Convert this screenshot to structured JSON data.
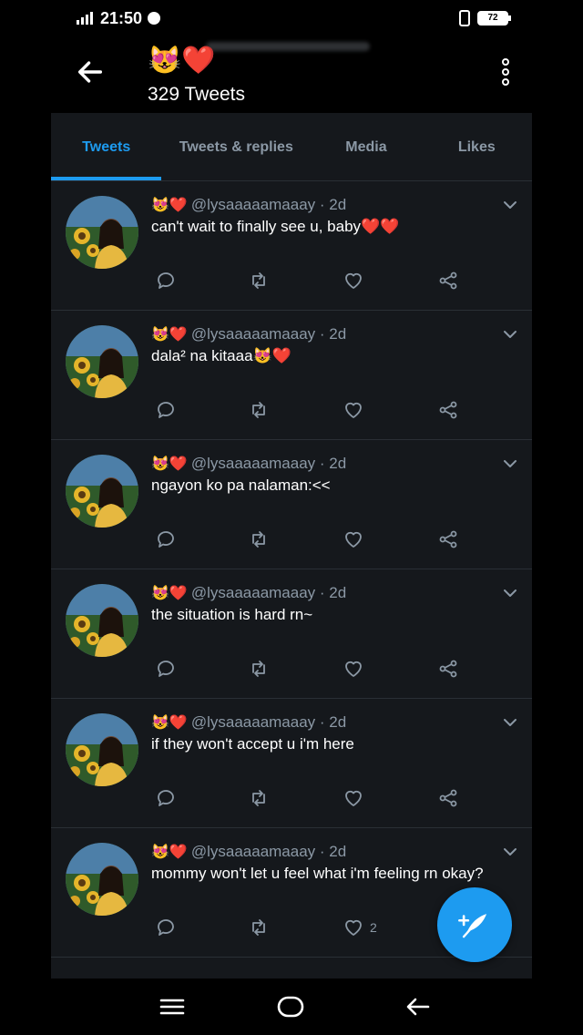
{
  "status_bar": {
    "time": "21:50",
    "battery": "72"
  },
  "header": {
    "name_emojis": "😻❤️",
    "tweet_count": "329 Tweets"
  },
  "tabs": [
    {
      "label": "Tweets",
      "active": true
    },
    {
      "label": "Tweets & replies",
      "active": false
    },
    {
      "label": "Media",
      "active": false
    },
    {
      "label": "Likes",
      "active": false
    }
  ],
  "tweets": [
    {
      "emojis": "😻❤️",
      "handle": "@lysaaaaamaaay · 2d",
      "text": "can't wait to finally see u, baby❤️❤️",
      "likes": ""
    },
    {
      "emojis": "😻❤️",
      "handle": "@lysaaaaamaaay · 2d",
      "text": "dala² na kitaaa😻❤️",
      "likes": ""
    },
    {
      "emojis": "😻❤️",
      "handle": "@lysaaaaamaaay · 2d",
      "text": "ngayon ko pa nalaman:<<",
      "likes": ""
    },
    {
      "emojis": "😻❤️",
      "handle": "@lysaaaaamaaay · 2d",
      "text": "the situation is hard rn~",
      "likes": ""
    },
    {
      "emojis": "😻❤️",
      "handle": "@lysaaaaamaaay · 2d",
      "text": "if they won't accept u i'm here",
      "likes": ""
    },
    {
      "emojis": "😻❤️",
      "handle": "@lysaaaaamaaay · 2d",
      "text": "mommy won't let u feel what i'm feeling rn okay?",
      "likes": "2"
    }
  ],
  "colors": {
    "accent": "#1d9bf0",
    "background": "#15181c",
    "muted": "#8b98a5"
  },
  "icons": [
    "back-arrow-icon",
    "more-vertical-icon",
    "reply-icon",
    "retweet-icon",
    "heart-icon",
    "share-icon",
    "chevron-down-icon",
    "compose-icon",
    "nav-menu-icon",
    "nav-home-icon",
    "nav-back-icon"
  ]
}
